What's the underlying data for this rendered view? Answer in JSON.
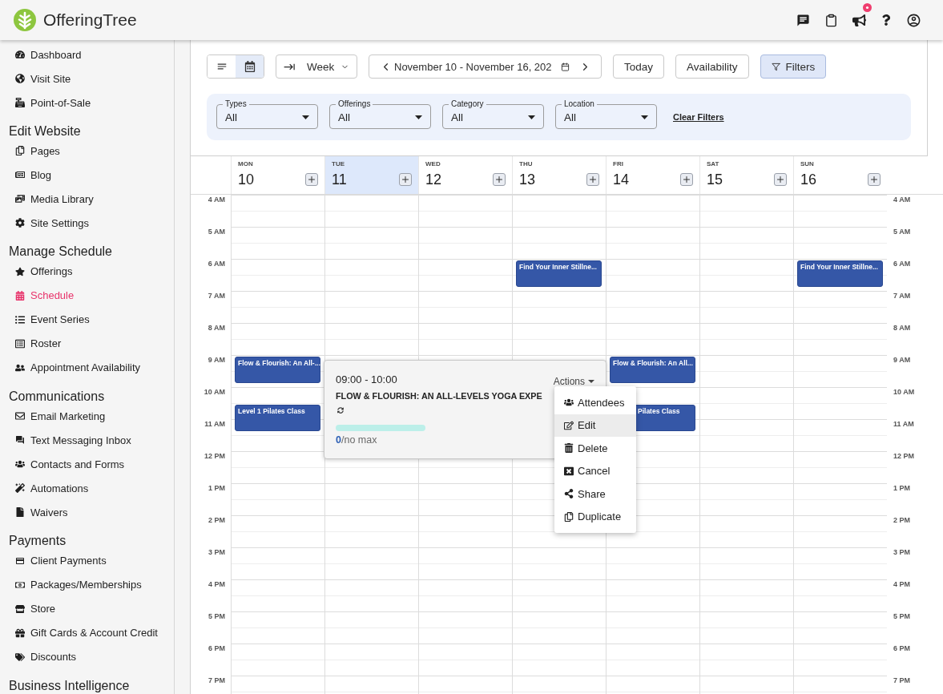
{
  "header": {
    "logo": "OfferingTree",
    "announcement_badge": true
  },
  "sidebar": {
    "groups": [
      {
        "items": [
          {
            "label": "Dashboard",
            "selected": false
          },
          {
            "label": "Visit Site",
            "selected": false
          },
          {
            "label": "Point-of-Sale",
            "selected": false
          }
        ]
      },
      {
        "heading": "Edit Website",
        "items": [
          {
            "label": "Pages",
            "selected": false
          },
          {
            "label": "Blog",
            "selected": false
          },
          {
            "label": "Media Library",
            "selected": false
          },
          {
            "label": "Site Settings",
            "selected": false
          }
        ]
      },
      {
        "heading": "Manage Schedule",
        "items": [
          {
            "label": "Offerings",
            "selected": false
          },
          {
            "label": "Schedule",
            "selected": true
          },
          {
            "label": "Event Series",
            "selected": false
          },
          {
            "label": "Roster",
            "selected": false
          },
          {
            "label": "Appointment Availability",
            "selected": false
          }
        ]
      },
      {
        "heading": "Communications",
        "items": [
          {
            "label": "Email Marketing",
            "selected": false
          },
          {
            "label": "Text Messaging Inbox",
            "selected": false
          },
          {
            "label": "Contacts and Forms",
            "selected": false
          },
          {
            "label": "Automations",
            "selected": false
          },
          {
            "label": "Waivers",
            "selected": false
          }
        ]
      },
      {
        "heading": "Payments",
        "items": [
          {
            "label": "Client Payments",
            "selected": false
          },
          {
            "label": "Packages/Memberships",
            "selected": false
          },
          {
            "label": "Store",
            "selected": false
          },
          {
            "label": "Gift Cards & Account Credit",
            "selected": false
          },
          {
            "label": "Discounts",
            "selected": false
          }
        ]
      },
      {
        "heading": "Business Intelligence"
      }
    ]
  },
  "toolbar": {
    "view_toggle": [
      {
        "selected": false
      },
      {
        "selected": true
      }
    ],
    "range": "Week",
    "date_range": "November 10 - November 16, 202",
    "buttons": [
      {
        "kind": "plain",
        "label": "Today",
        "active": false
      },
      {
        "kind": "plain",
        "label": "Availability",
        "active": false
      },
      {
        "kind": "filter",
        "label": "Filters",
        "active": true
      }
    ]
  },
  "filters": {
    "fields": [
      {
        "label": "Types",
        "value": "All"
      },
      {
        "label": "Offerings",
        "value": "All"
      },
      {
        "label": "Category",
        "value": "All"
      },
      {
        "label": "Location",
        "value": "All"
      }
    ],
    "clear": "Clear Filters"
  },
  "calendar": {
    "days": [
      {
        "weekday": "MON",
        "date": "10",
        "selected": false,
        "events": [
          {
            "title": "Flow & Flourish: An All-...",
            "under_menu": false
          },
          {
            "title": "Level 1 Pilates Class",
            "under_menu": false
          }
        ]
      },
      {
        "weekday": "TUE",
        "date": "11",
        "selected": true,
        "popup": {
          "time": "09:00 - 10:00",
          "actions_label": "Actions",
          "title": "FLOW & FLOURISH: AN ALL-LEVELS YOGA EXPE",
          "recurring": true,
          "level": 0,
          "capacity": "**0**/no max",
          "actions": [
            {
              "label": "Attendees",
              "highlighted": false
            },
            {
              "label": "Edit",
              "highlighted": true
            },
            {
              "label": "Delete",
              "highlighted": false
            },
            {
              "label": "Cancel",
              "highlighted": false
            },
            {
              "label": "Share",
              "highlighted": false
            },
            {
              "label": "Duplicate",
              "highlighted": false
            }
          ]
        }
      },
      {
        "weekday": "WED",
        "date": "12",
        "selected": false
      },
      {
        "weekday": "THU",
        "date": "13",
        "selected": false,
        "events": [
          {
            "title": "Find Your Inner Stillne...",
            "under_menu": false
          }
        ]
      },
      {
        "weekday": "FRI",
        "date": "14",
        "selected": false,
        "events": [
          {
            "title": "Flow & Flourish: An All...",
            "under_menu": false
          },
          {
            "title": "Pilates Class",
            "under_menu": true
          }
        ]
      },
      {
        "weekday": "SAT",
        "date": "15",
        "selected": false
      },
      {
        "weekday": "SUN",
        "date": "16",
        "selected": false,
        "events": [
          {
            "title": "Find Your Inner Stillne...",
            "under_menu": false
          }
        ]
      }
    ],
    "hours_left": [
      "4 AM",
      "5 AM",
      "6 AM",
      "7 AM",
      "8 AM",
      "9 AM",
      "10 AM",
      "11 AM",
      "12 PM",
      "1 PM",
      "2 PM",
      "3 PM",
      "4 PM",
      "5 PM",
      "6 PM",
      "7 PM"
    ],
    "hours_right": [
      "4 AM",
      "5 AM",
      "6 AM",
      "7 AM",
      "8 AM",
      "9 AM",
      "10 AM",
      "11 AM",
      "12 PM",
      "1 PM",
      "2 PM",
      "3 PM",
      "4 PM",
      "5 PM",
      "6 PM",
      "7 PM"
    ]
  }
}
